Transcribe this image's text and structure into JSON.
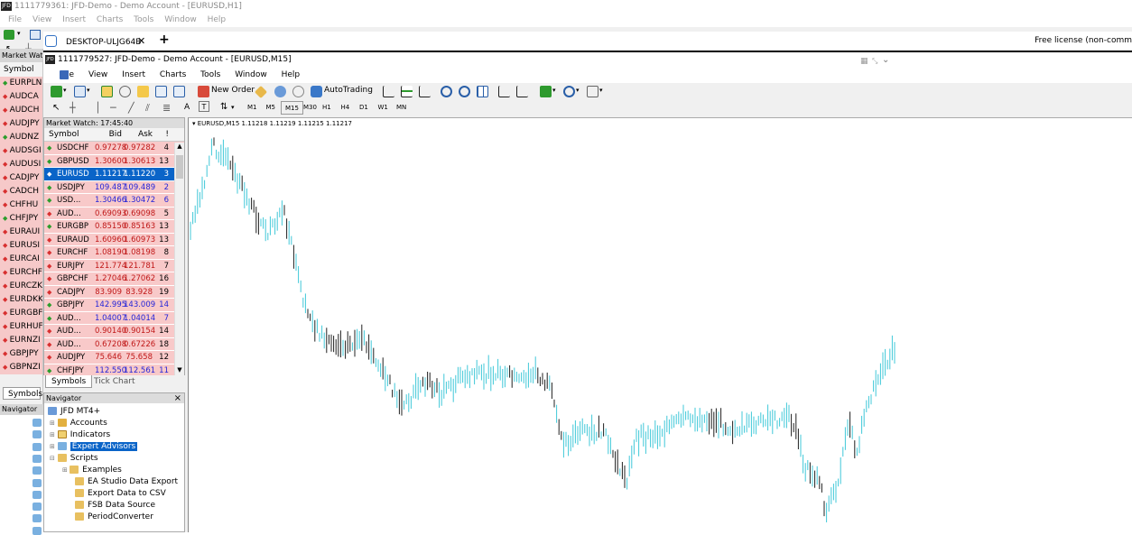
{
  "outer": {
    "title": "1111779361: JFD-Demo - Demo Account - [EURUSD,H1]",
    "logo": "JFD",
    "menu": [
      "File",
      "View",
      "Insert",
      "Charts",
      "Tools",
      "Window",
      "Help"
    ],
    "market_watch_label": "Market Watc",
    "symbol_header": "Symbol",
    "symbols": [
      {
        "s": "EURPLN",
        "d": "up"
      },
      {
        "s": "AUDCA",
        "d": "dn"
      },
      {
        "s": "AUDCH",
        "d": "dn"
      },
      {
        "s": "AUDJPY",
        "d": "dn"
      },
      {
        "s": "AUDNZ",
        "d": "up"
      },
      {
        "s": "AUDSGI",
        "d": "dn"
      },
      {
        "s": "AUDUSI",
        "d": "dn"
      },
      {
        "s": "CADJPY",
        "d": "dn"
      },
      {
        "s": "CADCH",
        "d": "dn"
      },
      {
        "s": "CHFHU",
        "d": "dn"
      },
      {
        "s": "CHFJPY",
        "d": "up"
      },
      {
        "s": "EURAUI",
        "d": "dn"
      },
      {
        "s": "EURUSI",
        "d": "dn"
      },
      {
        "s": "EURCAI",
        "d": "dn"
      },
      {
        "s": "EURCHF",
        "d": "dn"
      },
      {
        "s": "EURCZK",
        "d": "dn"
      },
      {
        "s": "EURDKK",
        "d": "dn"
      },
      {
        "s": "EURGBF",
        "d": "dn"
      },
      {
        "s": "EURHUF",
        "d": "dn"
      },
      {
        "s": "EURNZI",
        "d": "dn"
      },
      {
        "s": "GBPJPY",
        "d": "dn"
      },
      {
        "s": "GBPNZI",
        "d": "dn"
      }
    ],
    "symbols_tab": "Symbols",
    "navigator_label": "Navigator"
  },
  "remote": {
    "tab_label": "DESKTOP-ULJG64B",
    "close": "✕",
    "plus": "+",
    "license": "Free license (non-comm"
  },
  "inner": {
    "title": "1111779527: JFD-Demo - Demo Account - [EURUSD,M15]",
    "logo": "JFD",
    "menu": [
      "File",
      "View",
      "Insert",
      "Charts",
      "Tools",
      "Window",
      "Help"
    ],
    "toolbar": {
      "new_order": "New Order",
      "autotrading": "AutoTrading",
      "label_a": "A",
      "label_t": "T"
    },
    "timeframes": [
      "M1",
      "M5",
      "M15",
      "M30",
      "H1",
      "H4",
      "D1",
      "W1",
      "MN"
    ],
    "active_timeframe": "M15"
  },
  "market_watch": {
    "title": "Market Watch: 17:45:40",
    "columns": {
      "symbol": "Symbol",
      "bid": "Bid",
      "ask": "Ask",
      "spread": "!"
    },
    "rows": [
      {
        "symbol": "USDCHF",
        "bid": "0.97278",
        "ask": "0.97282",
        "spread": "4",
        "dir": "up",
        "color": "red"
      },
      {
        "symbol": "GBPUSD",
        "bid": "1.30600",
        "ask": "1.30613",
        "spread": "13",
        "dir": "up",
        "color": "red"
      },
      {
        "symbol": "EURUSD",
        "bid": "1.11217",
        "ask": "1.11220",
        "spread": "3",
        "dir": "dn",
        "color": "sel"
      },
      {
        "symbol": "USDJPY",
        "bid": "109.487",
        "ask": "109.489",
        "spread": "2",
        "dir": "up",
        "color": "blue"
      },
      {
        "symbol": "USD...",
        "bid": "1.30466",
        "ask": "1.30472",
        "spread": "6",
        "dir": "up",
        "color": "blue"
      },
      {
        "symbol": "AUD...",
        "bid": "0.69093",
        "ask": "0.69098",
        "spread": "5",
        "dir": "dn",
        "color": "red"
      },
      {
        "symbol": "EURGBP",
        "bid": "0.85150",
        "ask": "0.85163",
        "spread": "13",
        "dir": "up",
        "color": "red"
      },
      {
        "symbol": "EURAUD",
        "bid": "1.60960",
        "ask": "1.60973",
        "spread": "13",
        "dir": "dn",
        "color": "red"
      },
      {
        "symbol": "EURCHF",
        "bid": "1.08190",
        "ask": "1.08198",
        "spread": "8",
        "dir": "dn",
        "color": "red"
      },
      {
        "symbol": "EURJPY",
        "bid": "121.774",
        "ask": "121.781",
        "spread": "7",
        "dir": "dn",
        "color": "red"
      },
      {
        "symbol": "GBPCHF",
        "bid": "1.27046",
        "ask": "1.27062",
        "spread": "16",
        "dir": "dn",
        "color": "red"
      },
      {
        "symbol": "CADJPY",
        "bid": "83.909",
        "ask": "83.928",
        "spread": "19",
        "dir": "dn",
        "color": "red"
      },
      {
        "symbol": "GBPJPY",
        "bid": "142.995",
        "ask": "143.009",
        "spread": "14",
        "dir": "up",
        "color": "blue"
      },
      {
        "symbol": "AUD...",
        "bid": "1.04007",
        "ask": "1.04014",
        "spread": "7",
        "dir": "up",
        "color": "blue"
      },
      {
        "symbol": "AUD...",
        "bid": "0.90140",
        "ask": "0.90154",
        "spread": "14",
        "dir": "dn",
        "color": "red"
      },
      {
        "symbol": "AUD...",
        "bid": "0.67208",
        "ask": "0.67226",
        "spread": "18",
        "dir": "dn",
        "color": "red"
      },
      {
        "symbol": "AUDJPY",
        "bid": "75.646",
        "ask": "75.658",
        "spread": "12",
        "dir": "dn",
        "color": "red"
      },
      {
        "symbol": "CHFJPY",
        "bid": "112.550",
        "ask": "112.561",
        "spread": "11",
        "dir": "up",
        "color": "blue"
      }
    ],
    "tabs": [
      "Symbols",
      "Tick Chart"
    ]
  },
  "navigator": {
    "title": "Navigator",
    "close": "×",
    "root": "JFD MT4+",
    "items": [
      "Accounts",
      "Indicators",
      "Expert Advisors",
      "Scripts"
    ],
    "selected": "Expert Advisors",
    "scripts": [
      "Examples",
      "EA Studio Data Export",
      "Export Data to CSV",
      "FSB Data Source",
      "PeriodConverter"
    ]
  },
  "chart": {
    "label": "EURUSD,M15  1.11218 1.11219 1.11215 1.11217",
    "colors": {
      "bull": "#40c8d8",
      "bear": "#202020"
    }
  }
}
